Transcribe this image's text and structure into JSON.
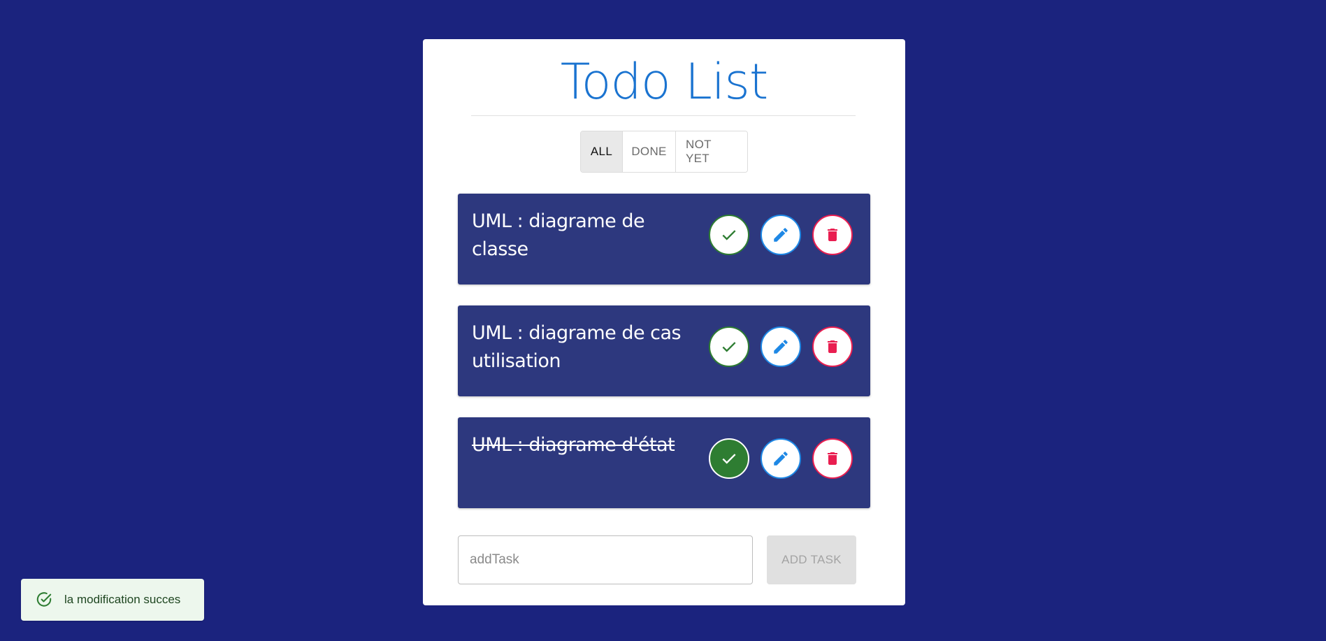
{
  "header": {
    "title": "Todo List"
  },
  "filters": [
    {
      "label": "ALL",
      "active": true
    },
    {
      "label": "DONE",
      "active": false
    },
    {
      "label": "NOT YET",
      "active": false
    }
  ],
  "tasks": [
    {
      "text": "UML : diagrame de classe",
      "done": false
    },
    {
      "text": "UML : diagrame de cas utilisation",
      "done": false
    },
    {
      "text": "UML : diagrame d'état",
      "done": true
    }
  ],
  "add_task": {
    "placeholder": "addTask",
    "value": "",
    "button_label": "ADD TASK"
  },
  "toast": {
    "message": "la modification succes"
  },
  "colors": {
    "background": "#1b237e",
    "title": "#1a73d0",
    "task_card": "#2d387e",
    "check": "#2e7d32",
    "edit": "#1e88e5",
    "delete": "#e91e50",
    "toast_bg": "#edf7ed"
  },
  "icons": {
    "check": "check-icon",
    "edit": "pencil-icon",
    "delete": "trash-icon",
    "toast": "check-circle-icon"
  }
}
